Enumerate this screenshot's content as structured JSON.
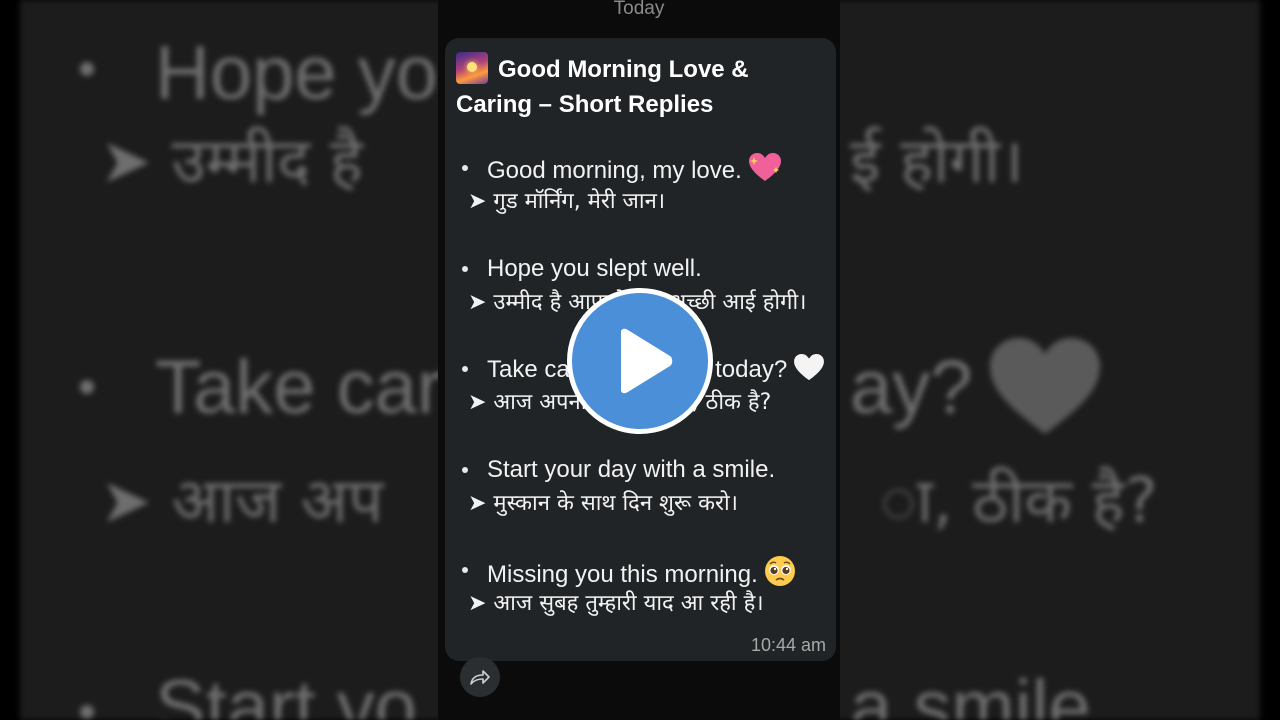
{
  "chat": {
    "date_separator": "Today",
    "message": {
      "title": "Good Morning Love & Caring – Short Replies",
      "items": [
        {
          "english": "Good morning, my love.",
          "hindi": "➤ गुड मॉर्निंग, मेरी जान।",
          "emoji": "sparkling-heart"
        },
        {
          "english": "Hope you slept well.",
          "hindi": "➤ उम्मीद है आपको नींद अच्छी आई होगी।",
          "emoji": ""
        },
        {
          "english": "Take care of yourself today?",
          "hindi": "➤ आज अपना ख्याल रखना, ठीक है?",
          "emoji": "white-heart"
        },
        {
          "english": "Start your day with a smile.",
          "hindi": "➤ मुस्कान के साथ दिन शुरू करो।",
          "emoji": ""
        },
        {
          "english": "Missing you this morning.",
          "hindi": "➤ आज सुबह तुम्हारी याद आ रही है।",
          "emoji": "pleading-face"
        }
      ],
      "time": "10:44 am"
    }
  },
  "background": {
    "line1": "Hope yo",
    "line2": "➤ उम्मीद है",
    "line2b": "ई होगी।",
    "line3": "Take car",
    "line3b": "ay?",
    "line4": "➤ आज अप",
    "line4b": "ा, ठीक है?",
    "line5": "Start yo",
    "line5b": "a smile"
  },
  "icons": {
    "forward": "forward-icon",
    "play": "play-icon"
  },
  "colors": {
    "bubble": "#202426",
    "play_button": "#4a8fd8",
    "background": "#1c1c1c"
  }
}
